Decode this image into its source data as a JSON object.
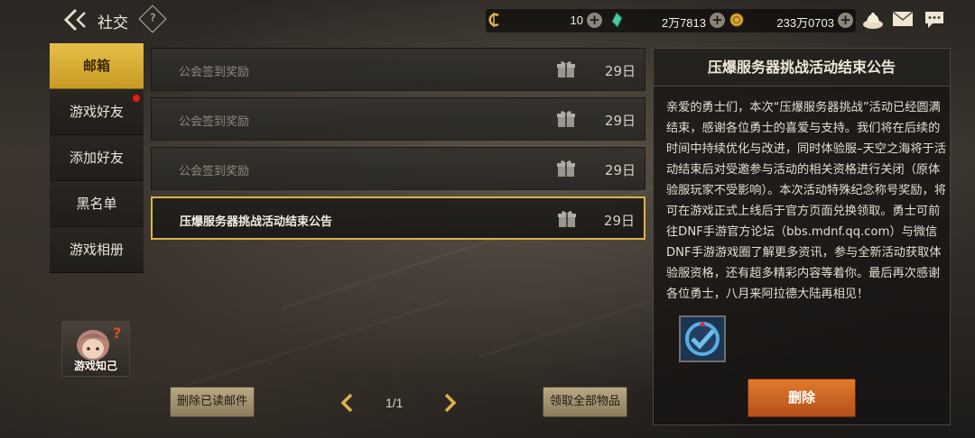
{
  "header": {
    "title": "社交",
    "back_icon": "back-arrow-icon",
    "help_symbol": "?"
  },
  "currencies": [
    {
      "icon": "coin-c-icon",
      "value": "10"
    },
    {
      "icon": "crystal-icon",
      "value": "2万7813"
    },
    {
      "icon": "gold-icon",
      "value": "233万0703"
    }
  ],
  "top_icons": [
    "shop-icon",
    "mail-envelope-icon",
    "chat-bubble-icon"
  ],
  "nav": {
    "items": [
      {
        "label": "邮箱",
        "active": true,
        "badge": false
      },
      {
        "label": "游戏好友",
        "active": false,
        "badge": true
      },
      {
        "label": "添加好友",
        "active": false,
        "badge": false
      },
      {
        "label": "黑名单",
        "active": false,
        "badge": false
      },
      {
        "label": "游戏相册",
        "active": false,
        "badge": false
      }
    ],
    "helper_label": "游戏知己"
  },
  "mails": [
    {
      "title": "公会签到奖励",
      "date": "29日",
      "selected": false
    },
    {
      "title": "公会签到奖励",
      "date": "29日",
      "selected": false
    },
    {
      "title": "公会签到奖励",
      "date": "29日",
      "selected": false
    },
    {
      "title": "压爆服务器挑战活动结束公告",
      "date": "29日",
      "selected": true
    }
  ],
  "footer": {
    "delete_read_label": "删除已读邮件",
    "page_indicator": "1/1",
    "claim_all_label": "领取全部物品"
  },
  "detail": {
    "title": "压爆服务器挑战活动结束公告",
    "body": "亲爱的勇士们，本次“压爆服务器挑战”活动已经圆满结束，感谢各位勇士的喜爱与支持。我们将在后续的时间中持续优化与改进，同时体验服–天空之海将于活动结束后对受邀参与活动的相关资格进行关闭（原体验服玩家不受影响）。本次活动特殊纪念称号奖励，将可在游戏正式上线后于官方页面兑换领取。勇士可前往DNF手游官方论坛（bbs.mdnf.qq.com）与微信DNF手游游戏圈了解更多资讯，参与全新活动获取体验服资格，还有超多精彩内容等着你。最后再次感谢各位勇士，八月来阿拉德大陆再相见！",
    "reward_icon": "title-reward-badge-icon",
    "delete_label": "删除"
  },
  "colors": {
    "accent_gold": "#d9b34b",
    "delete_orange": "#d86a25",
    "badge_red": "#d6251c"
  }
}
